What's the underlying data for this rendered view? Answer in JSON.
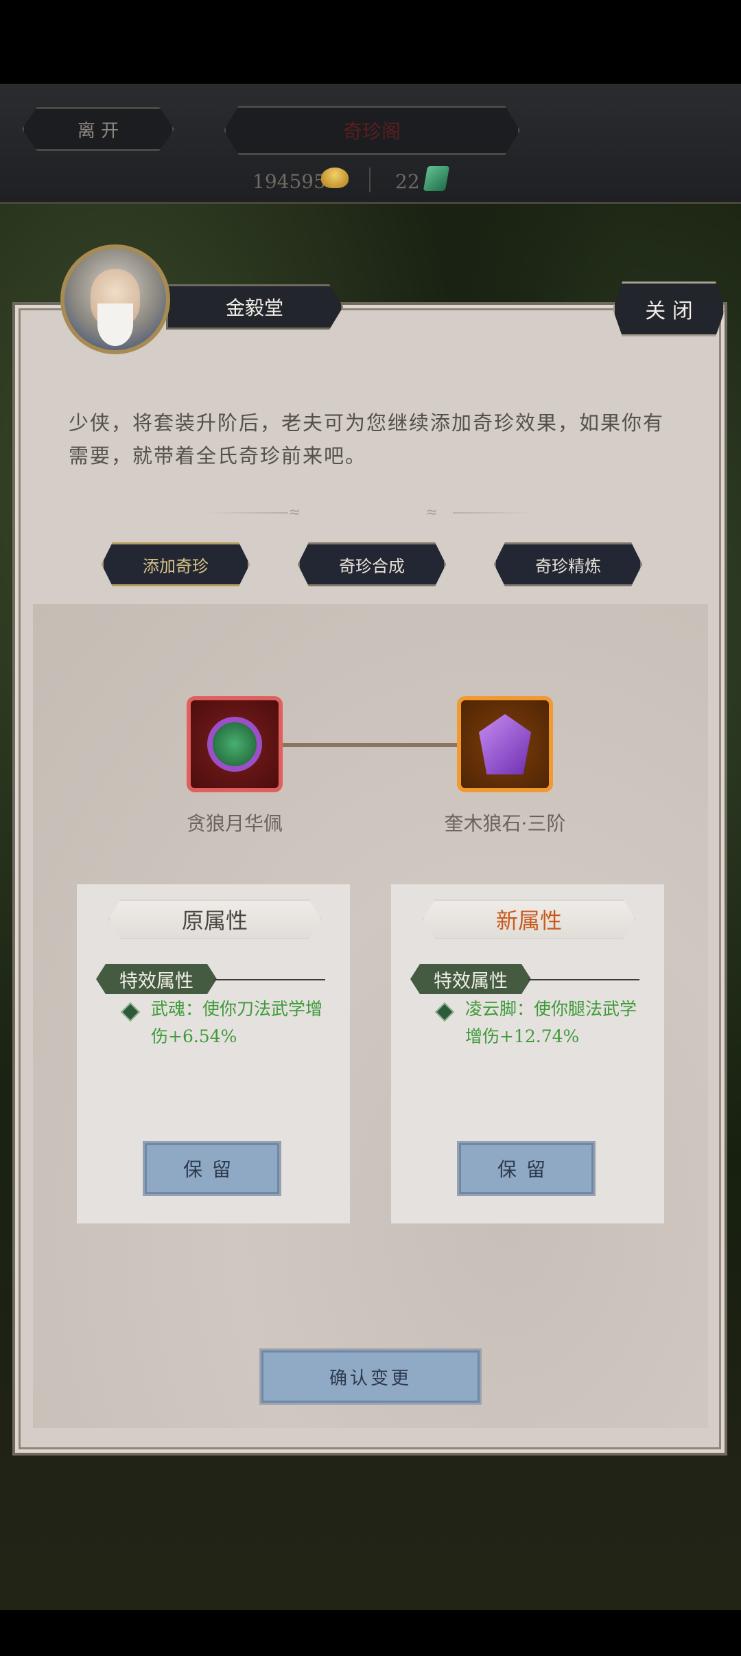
{
  "topbar": {
    "leave_label": "离 开",
    "title": "奇珍阁",
    "gold_value": "194595",
    "jade_value": "22",
    "gold_icon": "gold-ingot-icon",
    "jade_icon": "jade-token-icon"
  },
  "npc": {
    "name": "金毅堂",
    "avatar_icon": "old-master-portrait"
  },
  "close_label": "关 闭",
  "intro_text": "少侠，将套装升阶后，老夫可为您继续添加奇珍效果，如果你有需要，就带着全氏奇珍前来吧。",
  "tabs": [
    {
      "label": "添加奇珍",
      "active": true
    },
    {
      "label": "奇珍合成",
      "active": false
    },
    {
      "label": "奇珍精炼",
      "active": false
    }
  ],
  "items": [
    {
      "name": "贪狼月华佩",
      "icon": "jade-pendant-icon",
      "frame_color": "#e06060"
    },
    {
      "name": "奎木狼石·三阶",
      "icon": "purple-wolf-stone-icon",
      "frame_color": "#f29a32"
    }
  ],
  "cards": {
    "old": {
      "title": "原属性",
      "section": "特效属性",
      "effect": "武魂：使你刀法武学增伤+6.54%",
      "keep_label": "保留"
    },
    "new": {
      "title": "新属性",
      "section": "特效属性",
      "effect": "凌云脚：使你腿法武学增伤+12.74%",
      "keep_label": "保留"
    }
  },
  "confirm_label": "确认变更",
  "colors": {
    "panel_bg": "#d5cdc7",
    "effect_text": "#3e9a3a",
    "new_title": "#c85a1e",
    "button_blue": "#90a9c5"
  }
}
